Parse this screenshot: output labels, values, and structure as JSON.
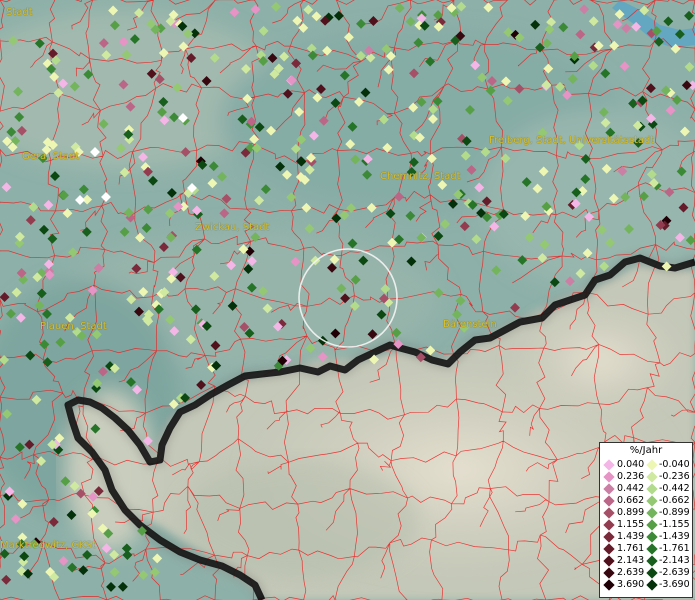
{
  "map": {
    "background_color": "#8fb1a9",
    "border_color": "#ee1c1c",
    "label_color": "#d8c02a",
    "cities": [
      {
        "name": "Stadt"
      },
      {
        "name": "Gera, Stadt"
      },
      {
        "name": "Freiberg, Stadt, Universitätsstadt"
      },
      {
        "name": "Chemnitz, Stadt"
      },
      {
        "name": "Zwickau, Stadt"
      },
      {
        "name": "Plauen, Stadt"
      },
      {
        "name": "Bärenstein"
      },
      {
        "name": "Marktredwitz, GKSt"
      }
    ]
  },
  "legend": {
    "title": "%/Jahr",
    "rows": [
      {
        "pos": "0.040",
        "neg": "-0.040",
        "pos_color": "#f4b6e6",
        "neg_color": "#eef6b4"
      },
      {
        "pos": "0.236",
        "neg": "-0.236",
        "pos_color": "#e693c6",
        "neg_color": "#cfe9a0"
      },
      {
        "pos": "0.442",
        "neg": "-0.442",
        "pos_color": "#cc7fa4",
        "neg_color": "#b3db8c"
      },
      {
        "pos": "0.662",
        "neg": "-0.662",
        "pos_color": "#bb6686",
        "neg_color": "#94c873"
      },
      {
        "pos": "0.899",
        "neg": "-0.899",
        "pos_color": "#a65068",
        "neg_color": "#73b45d"
      },
      {
        "pos": "1.155",
        "neg": "-1.155",
        "pos_color": "#933c50",
        "neg_color": "#579f47"
      },
      {
        "pos": "1.439",
        "neg": "-1.439",
        "pos_color": "#7a2a3a",
        "neg_color": "#3c8a37"
      },
      {
        "pos": "1.761",
        "neg": "-1.761",
        "pos_color": "#651c2a",
        "neg_color": "#267428"
      },
      {
        "pos": "2.143",
        "neg": "-2.143",
        "pos_color": "#50101c",
        "neg_color": "#185e1c"
      },
      {
        "pos": "2.639",
        "neg": "-2.639",
        "pos_color": "#380810",
        "neg_color": "#0c4812"
      },
      {
        "pos": "3.690",
        "neg": "-3.690",
        "pos_color": "#1f0006",
        "neg_color": "#04300a"
      }
    ]
  }
}
